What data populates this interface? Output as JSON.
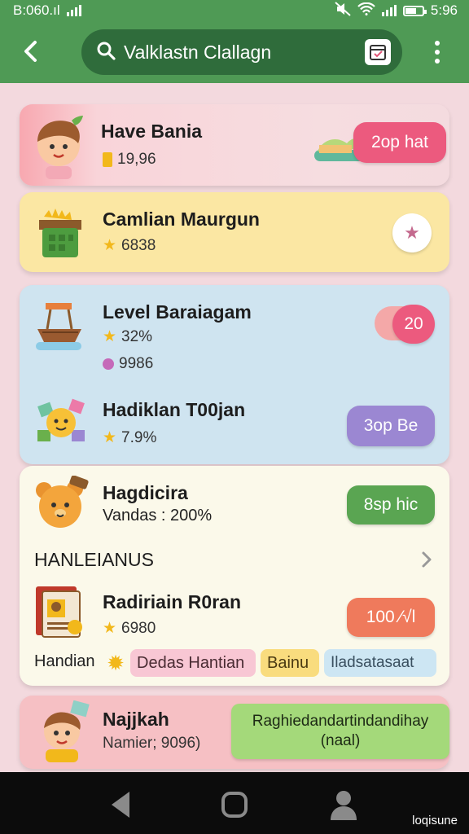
{
  "status": {
    "time_left": "B:060.ıl",
    "time_right": "5:96"
  },
  "header": {
    "search_query": "Valklastn Clallagn"
  },
  "cards": [
    {
      "title": "Have Bania",
      "meta": "19,96",
      "action": "2op hat"
    },
    {
      "title": "Camlian Maurgun",
      "meta": "6838"
    },
    {
      "title": "Level Baraiagam",
      "meta": "32%",
      "meta2": "9986",
      "action": "20"
    },
    {
      "title": "Hadiklan T00jan",
      "meta": "7.9%",
      "action": "3op Be"
    },
    {
      "title": "Hagdicira",
      "meta": "Vandas : 200%",
      "action": "8sp hic"
    },
    {
      "title": "Radiriain R0ran",
      "meta": "6980",
      "action": "100 ∕√l"
    },
    {
      "title": "Najjkah",
      "meta": "Namier; 9096)",
      "action_line1": "Raghiedandartindandihay",
      "action_line2": "(naal)"
    }
  ],
  "section": {
    "heading": "HANLEIANUS"
  },
  "tags": {
    "lead": "Handian",
    "chips": [
      "Dedas Hantian",
      "Bainu",
      "Iladsatasaat"
    ]
  },
  "footer": {
    "watermark": "loqisune"
  },
  "colors": {
    "appbar": "#4f9a55",
    "search_bg": "#2f6c3b",
    "pink_btn": "#ec5a7e",
    "purple_btn": "#9b87d2",
    "green_btn": "#5aa552",
    "orange_btn": "#ef7a5c"
  }
}
